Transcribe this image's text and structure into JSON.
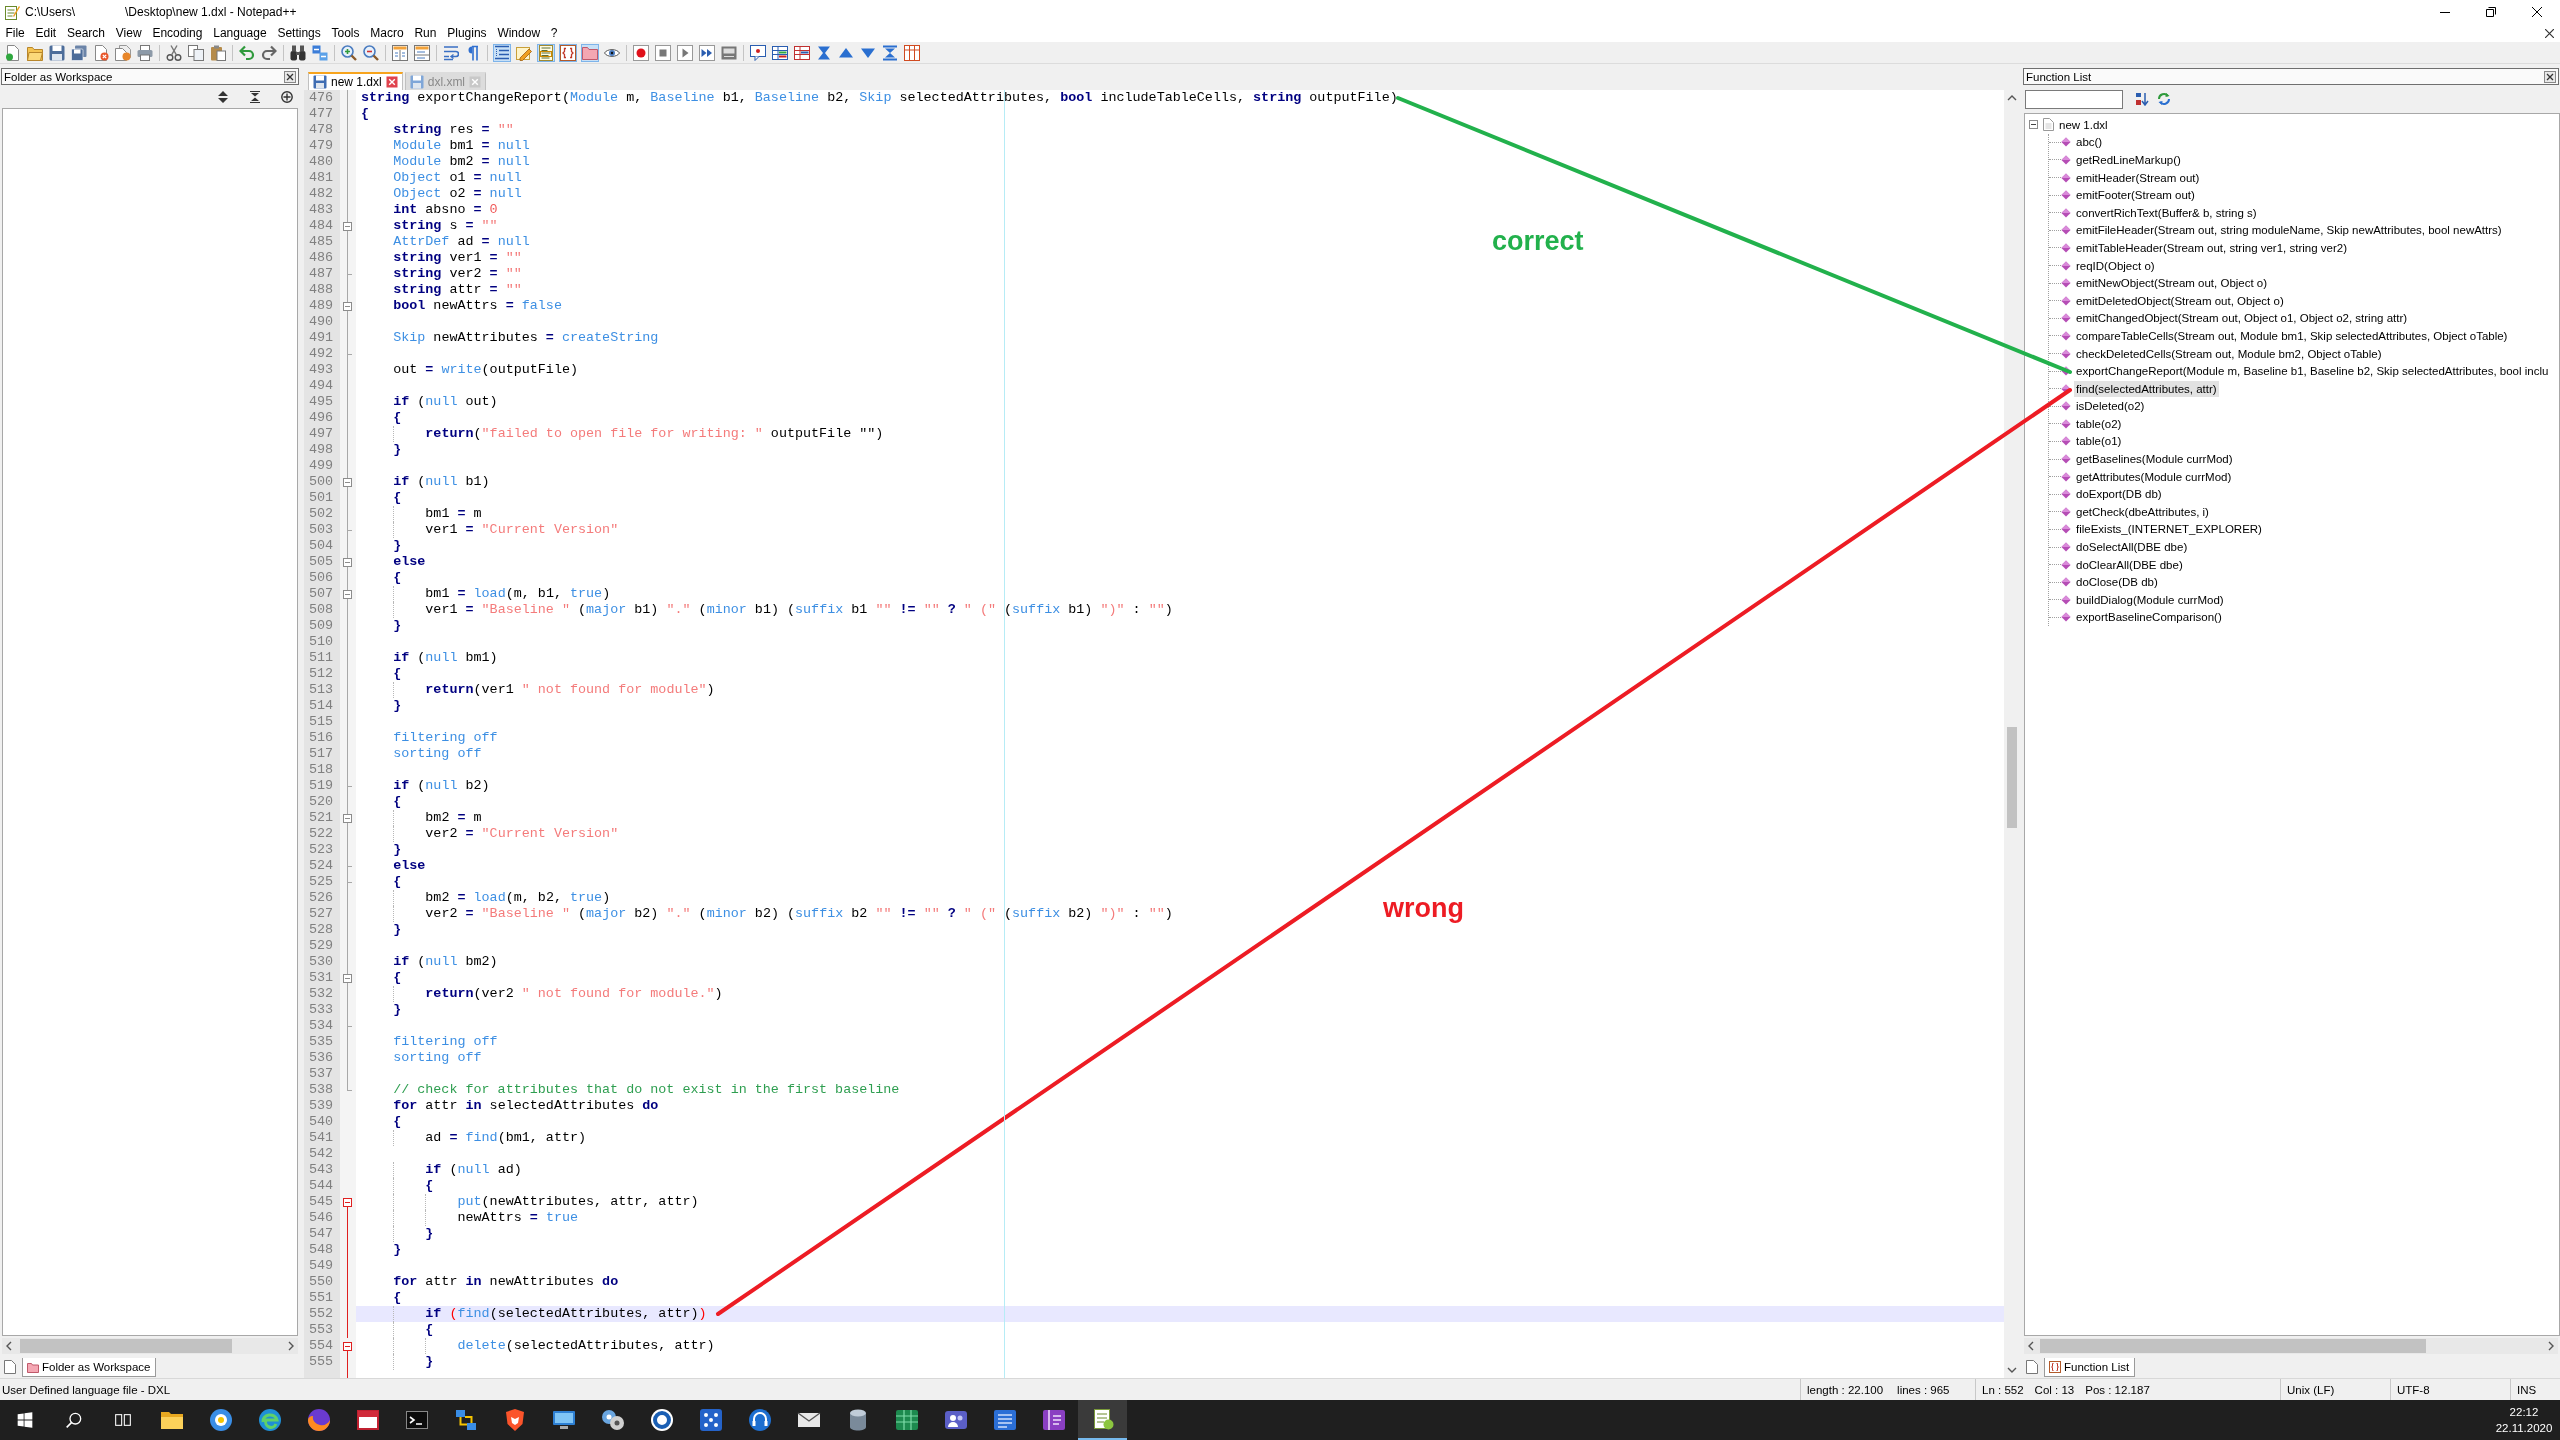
{
  "window": {
    "title_segments": [
      "C:\\Users\\",
      "\\Desktop\\new 1.dxl - Notepad++"
    ]
  },
  "menu": [
    "File",
    "Edit",
    "Search",
    "View",
    "Encoding",
    "Language",
    "Settings",
    "Tools",
    "Macro",
    "Run",
    "Plugins",
    "Window",
    "?"
  ],
  "toolbar": [
    {
      "pressed": false
    },
    {
      "pressed": false
    },
    {
      "pressed": false
    },
    {
      "pressed": false
    },
    {
      "pressed": false
    },
    {
      "pressed": false
    },
    {
      "pressed": false
    },
    {
      "pressed": false
    },
    {
      "pressed": false
    },
    {
      "pressed": false
    },
    {
      "pressed": false
    },
    {
      "pressed": false
    },
    {
      "pressed": false
    },
    {
      "pressed": false
    },
    {
      "pressed": false
    },
    {
      "pressed": false
    },
    {
      "pressed": false
    },
    {
      "pressed": false
    },
    {
      "pressed": false
    },
    {
      "pressed": false
    },
    {
      "pressed": true
    },
    {
      "pressed": false
    },
    {
      "pressed": true
    },
    {
      "pressed": true
    },
    {
      "pressed": true
    },
    {
      "pressed": false
    },
    {
      "pressed": false
    },
    {
      "pressed": false
    },
    {
      "pressed": false
    },
    {
      "pressed": false
    },
    {
      "pressed": false
    },
    {
      "pressed": false
    },
    {
      "pressed": false
    },
    {
      "pressed": false
    },
    {
      "pressed": false
    },
    {
      "pressed": false
    },
    {
      "pressed": false
    },
    {
      "pressed": false
    },
    {
      "pressed": false
    }
  ],
  "workspace_panel": {
    "title": "Folder as Workspace",
    "tab": "Folder as Workspace"
  },
  "editor": {
    "tabs": [
      {
        "label": "new 1.dxl",
        "selected": true
      },
      {
        "label": "dxl.xml",
        "selected": false
      }
    ],
    "lines": [
      {
        "number": "476",
        "current": false,
        "kind": "guide",
        "code": [
          {
            "text": "string",
            "kind": "keyword"
          },
          {
            "text": " exportChangeReport(",
            "kind": "plain"
          },
          {
            "text": "Module",
            "kind": "builtin"
          },
          {
            "text": " m, ",
            "kind": "plain"
          },
          {
            "text": "Baseline",
            "kind": "builtin"
          },
          {
            "text": " b1, ",
            "kind": "plain"
          },
          {
            "text": "Baseline",
            "kind": "builtin"
          },
          {
            "text": " b2, ",
            "kind": "plain"
          },
          {
            "text": "Skip",
            "kind": "builtin"
          },
          {
            "text": " selectedAttributes, ",
            "kind": "plain"
          },
          {
            "text": "bool",
            "kind": "keyword"
          },
          {
            "text": " includeTableCells, ",
            "kind": "plain"
          },
          {
            "text": "string",
            "kind": "keyword"
          },
          {
            "text": " outputFile)",
            "kind": "plain"
          }
        ]
      },
      {
        "number": "477",
        "current": false,
        "kind": "guide",
        "code": [
          {
            "text": "{",
            "kind": "operator"
          }
        ]
      },
      {
        "number": "478",
        "current": false,
        "kind": "guide",
        "code": [
          {
            "text": "    string",
            "kind": "keyword"
          },
          {
            "text": " res ",
            "kind": "plain"
          },
          {
            "text": "=",
            "kind": "operator"
          },
          {
            "text": " \"\"",
            "kind": "string"
          }
        ]
      },
      {
        "number": "479",
        "current": false,
        "kind": "guide",
        "code": [
          {
            "text": "    Module",
            "kind": "builtin"
          },
          {
            "text": " bm1 ",
            "kind": "plain"
          },
          {
            "text": "=",
            "kind": "operator"
          },
          {
            "text": " null",
            "kind": "builtin"
          }
        ]
      },
      {
        "number": "480",
        "current": false,
        "kind": "guide",
        "code": [
          {
            "text": "    Module",
            "kind": "builtin"
          },
          {
            "text": " bm2 ",
            "kind": "plain"
          },
          {
            "text": "=",
            "kind": "operator"
          },
          {
            "text": " null",
            "kind": "builtin"
          }
        ]
      },
      {
        "number": "481",
        "current": false,
        "kind": "guide",
        "code": [
          {
            "text": "    Object",
            "kind": "builtin"
          },
          {
            "text": " o1 ",
            "kind": "plain"
          },
          {
            "text": "=",
            "kind": "operator"
          },
          {
            "text": " null",
            "kind": "builtin"
          }
        ]
      },
      {
        "number": "482",
        "current": false,
        "kind": "guide",
        "code": [
          {
            "text": "    Object",
            "kind": "builtin"
          },
          {
            "text": " o2 ",
            "kind": "plain"
          },
          {
            "text": "=",
            "kind": "operator"
          },
          {
            "text": " null",
            "kind": "builtin"
          }
        ]
      },
      {
        "number": "483",
        "current": false,
        "kind": "guide",
        "code": [
          {
            "text": "    int",
            "kind": "keyword"
          },
          {
            "text": " absno ",
            "kind": "plain"
          },
          {
            "text": "=",
            "kind": "operator"
          },
          {
            "text": " 0",
            "kind": "number"
          }
        ]
      },
      {
        "number": "484",
        "current": false,
        "kind": "folder",
        "code": [
          {
            "text": "    string",
            "kind": "keyword"
          },
          {
            "text": " s ",
            "kind": "plain"
          },
          {
            "text": "=",
            "kind": "operator"
          },
          {
            "text": " \"\"",
            "kind": "string"
          }
        ]
      },
      {
        "number": "485",
        "current": false,
        "kind": "guide",
        "code": [
          {
            "text": "    AttrDef",
            "kind": "builtin"
          },
          {
            "text": " ad ",
            "kind": "plain"
          },
          {
            "text": "=",
            "kind": "operator"
          },
          {
            "text": " null",
            "kind": "builtin"
          }
        ]
      },
      {
        "number": "486",
        "current": false,
        "kind": "guide",
        "code": [
          {
            "text": "    string",
            "kind": "keyword"
          },
          {
            "text": " ver1 ",
            "kind": "plain"
          },
          {
            "text": "=",
            "kind": "operator"
          },
          {
            "text": " \"\"",
            "kind": "string"
          }
        ]
      },
      {
        "number": "487",
        "current": false,
        "kind": "tick",
        "code": [
          {
            "text": "    string",
            "kind": "keyword"
          },
          {
            "text": " ver2 ",
            "kind": "plain"
          },
          {
            "text": "=",
            "kind": "operator"
          },
          {
            "text": " \"\"",
            "kind": "string"
          }
        ]
      },
      {
        "number": "488",
        "current": false,
        "kind": "guide",
        "code": [
          {
            "text": "    string",
            "kind": "keyword"
          },
          {
            "text": " attr ",
            "kind": "plain"
          },
          {
            "text": "=",
            "kind": "operator"
          },
          {
            "text": " \"\"",
            "kind": "string"
          }
        ]
      },
      {
        "number": "489",
        "current": false,
        "kind": "folder",
        "code": [
          {
            "text": "    bool",
            "kind": "keyword"
          },
          {
            "text": " newAttrs ",
            "kind": "plain"
          },
          {
            "text": "=",
            "kind": "operator"
          },
          {
            "text": " false",
            "kind": "builtin"
          }
        ]
      },
      {
        "number": "490",
        "current": false,
        "kind": "guide"
      },
      {
        "number": "491",
        "current": false,
        "kind": "guide",
        "code": [
          {
            "text": "    Skip",
            "kind": "builtin"
          },
          {
            "text": " newAttributes ",
            "kind": "plain"
          },
          {
            "text": "=",
            "kind": "operator"
          },
          {
            "text": " createString",
            "kind": "builtin"
          }
        ]
      },
      {
        "number": "492",
        "current": false,
        "kind": "tick"
      },
      {
        "number": "493",
        "current": false,
        "kind": "guide",
        "code": [
          {
            "text": "    out ",
            "kind": "plain"
          },
          {
            "text": "=",
            "kind": "operator"
          },
          {
            "text": " write",
            "kind": "builtin"
          },
          {
            "text": "(outputFile)",
            "kind": "plain"
          }
        ]
      },
      {
        "number": "494",
        "current": false,
        "kind": "guide"
      },
      {
        "number": "495",
        "current": false,
        "kind": "guide",
        "code": [
          {
            "text": "    if",
            "kind": "keyword"
          },
          {
            "text": " (",
            "kind": "plain"
          },
          {
            "text": "null",
            "kind": "builtin"
          },
          {
            "text": " out)",
            "kind": "plain"
          }
        ]
      },
      {
        "number": "496",
        "current": false,
        "kind": "guide",
        "code": [
          {
            "text": "    {",
            "kind": "operator"
          }
        ]
      },
      {
        "number": "497",
        "current": false,
        "kind": "guide",
        "code": [
          {
            "text": "        return",
            "kind": "keyword"
          },
          {
            "text": "(",
            "kind": "plain"
          },
          {
            "text": "\"failed to open file for writing: \"",
            "kind": "string"
          },
          {
            "text": " outputFile \"\")",
            "kind": "plain"
          }
        ]
      },
      {
        "number": "498",
        "current": false,
        "kind": "guide",
        "code": [
          {
            "text": "    }",
            "kind": "operator"
          }
        ]
      },
      {
        "number": "499",
        "current": false,
        "kind": "guide"
      },
      {
        "number": "500",
        "current": false,
        "kind": "folder",
        "code": [
          {
            "text": "    if",
            "kind": "keyword"
          },
          {
            "text": " (",
            "kind": "plain"
          },
          {
            "text": "null",
            "kind": "builtin"
          },
          {
            "text": " b1)",
            "kind": "plain"
          }
        ]
      },
      {
        "number": "501",
        "current": false,
        "kind": "guide",
        "code": [
          {
            "text": "    {",
            "kind": "operator"
          }
        ]
      },
      {
        "number": "502",
        "current": false,
        "kind": "guide",
        "code": [
          {
            "text": "        bm1 ",
            "kind": "plain"
          },
          {
            "text": "=",
            "kind": "operator"
          },
          {
            "text": " m",
            "kind": "plain"
          }
        ]
      },
      {
        "number": "503",
        "current": false,
        "kind": "tick",
        "code": [
          {
            "text": "        ver1 ",
            "kind": "plain"
          },
          {
            "text": "=",
            "kind": "operator"
          },
          {
            "text": " \"Current Version\"",
            "kind": "string"
          }
        ]
      },
      {
        "number": "504",
        "current": false,
        "kind": "guide",
        "code": [
          {
            "text": "    }",
            "kind": "operator"
          }
        ]
      },
      {
        "number": "505",
        "current": false,
        "kind": "folder",
        "code": [
          {
            "text": "    else",
            "kind": "keyword"
          }
        ]
      },
      {
        "number": "506",
        "current": false,
        "kind": "guide",
        "code": [
          {
            "text": "    {",
            "kind": "operator"
          }
        ]
      },
      {
        "number": "507",
        "current": false,
        "kind": "folder",
        "code": [
          {
            "text": "        bm1 ",
            "kind": "plain"
          },
          {
            "text": "=",
            "kind": "operator"
          },
          {
            "text": " load",
            "kind": "builtin"
          },
          {
            "text": "(m, b1, ",
            "kind": "plain"
          },
          {
            "text": "true",
            "kind": "builtin"
          },
          {
            "text": ")",
            "kind": "plain"
          }
        ]
      },
      {
        "number": "508",
        "current": false,
        "kind": "guide",
        "code": [
          {
            "text": "        ver1 ",
            "kind": "plain"
          },
          {
            "text": "=",
            "kind": "operator"
          },
          {
            "text": " \"Baseline \"",
            "kind": "string"
          },
          {
            "text": " (",
            "kind": "plain"
          },
          {
            "text": "major",
            "kind": "builtin"
          },
          {
            "text": " b1) ",
            "kind": "plain"
          },
          {
            "text": "\".\"",
            "kind": "string"
          },
          {
            "text": " (",
            "kind": "plain"
          },
          {
            "text": "minor",
            "kind": "builtin"
          },
          {
            "text": " b1) (",
            "kind": "plain"
          },
          {
            "text": "suffix",
            "kind": "builtin"
          },
          {
            "text": " b1 ",
            "kind": "plain"
          },
          {
            "text": "\"\"",
            "kind": "string"
          },
          {
            "text": " !=",
            "kind": "operator"
          },
          {
            "text": " \"\"",
            "kind": "string"
          },
          {
            "text": " ?",
            "kind": "operator"
          },
          {
            "text": " \" (\"",
            "kind": "string"
          },
          {
            "text": " (",
            "kind": "plain"
          },
          {
            "text": "suffix",
            "kind": "builtin"
          },
          {
            "text": " b1) ",
            "kind": "plain"
          },
          {
            "text": "\")\"",
            "kind": "string"
          },
          {
            "text": " : ",
            "kind": "plain"
          },
          {
            "text": "\"\"",
            "kind": "string"
          },
          {
            "text": ")",
            "kind": "plain"
          }
        ]
      },
      {
        "number": "509",
        "current": false,
        "kind": "guide",
        "code": [
          {
            "text": "    }",
            "kind": "operator"
          }
        ]
      },
      {
        "number": "510",
        "current": false,
        "kind": "guide"
      },
      {
        "number": "511",
        "current": false,
        "kind": "guide",
        "code": [
          {
            "text": "    if",
            "kind": "keyword"
          },
          {
            "text": " (",
            "kind": "plain"
          },
          {
            "text": "null",
            "kind": "builtin"
          },
          {
            "text": " bm1)",
            "kind": "plain"
          }
        ]
      },
      {
        "number": "512",
        "current": false,
        "kind": "guide",
        "code": [
          {
            "text": "    {",
            "kind": "operator"
          }
        ]
      },
      {
        "number": "513",
        "current": false,
        "kind": "guide",
        "code": [
          {
            "text": "        return",
            "kind": "keyword"
          },
          {
            "text": "(ver1 ",
            "kind": "plain"
          },
          {
            "text": "\" not found for module\"",
            "kind": "string"
          },
          {
            "text": ")",
            "kind": "plain"
          }
        ]
      },
      {
        "number": "514",
        "current": false,
        "kind": "guide",
        "code": [
          {
            "text": "    }",
            "kind": "operator"
          }
        ]
      },
      {
        "number": "515",
        "current": false,
        "kind": "guide"
      },
      {
        "number": "516",
        "current": false,
        "kind": "guide",
        "code": [
          {
            "text": "    filtering off",
            "kind": "builtin"
          }
        ]
      },
      {
        "number": "517",
        "current": false,
        "kind": "guide",
        "code": [
          {
            "text": "    sorting off",
            "kind": "builtin"
          }
        ]
      },
      {
        "number": "518",
        "current": false,
        "kind": "guide"
      },
      {
        "number": "519",
        "current": false,
        "kind": "tick",
        "code": [
          {
            "text": "    if",
            "kind": "keyword"
          },
          {
            "text": " (",
            "kind": "plain"
          },
          {
            "text": "null",
            "kind": "builtin"
          },
          {
            "text": " b2)",
            "kind": "plain"
          }
        ]
      },
      {
        "number": "520",
        "current": false,
        "kind": "guide",
        "code": [
          {
            "text": "    {",
            "kind": "operator"
          }
        ]
      },
      {
        "number": "521",
        "current": false,
        "kind": "folder",
        "code": [
          {
            "text": "        bm2 ",
            "kind": "plain"
          },
          {
            "text": "=",
            "kind": "operator"
          },
          {
            "text": " m",
            "kind": "plain"
          }
        ]
      },
      {
        "number": "522",
        "current": false,
        "kind": "guide",
        "code": [
          {
            "text": "        ver2 ",
            "kind": "plain"
          },
          {
            "text": "=",
            "kind": "operator"
          },
          {
            "text": " \"Current Version\"",
            "kind": "string"
          }
        ]
      },
      {
        "number": "523",
        "current": false,
        "kind": "guide",
        "code": [
          {
            "text": "    }",
            "kind": "operator"
          }
        ]
      },
      {
        "number": "524",
        "current": false,
        "kind": "tick",
        "code": [
          {
            "text": "    else",
            "kind": "keyword"
          }
        ]
      },
      {
        "number": "525",
        "current": false,
        "kind": "tick",
        "code": [
          {
            "text": "    {",
            "kind": "operator"
          }
        ]
      },
      {
        "number": "526",
        "current": false,
        "kind": "guide",
        "code": [
          {
            "text": "        bm2 ",
            "kind": "plain"
          },
          {
            "text": "=",
            "kind": "operator"
          },
          {
            "text": " load",
            "kind": "builtin"
          },
          {
            "text": "(m, b2, ",
            "kind": "plain"
          },
          {
            "text": "true",
            "kind": "builtin"
          },
          {
            "text": ")",
            "kind": "plain"
          }
        ]
      },
      {
        "number": "527",
        "current": false,
        "kind": "guide",
        "code": [
          {
            "text": "        ver2 ",
            "kind": "plain"
          },
          {
            "text": "=",
            "kind": "operator"
          },
          {
            "text": " \"Baseline \"",
            "kind": "string"
          },
          {
            "text": " (",
            "kind": "plain"
          },
          {
            "text": "major",
            "kind": "builtin"
          },
          {
            "text": " b2) ",
            "kind": "plain"
          },
          {
            "text": "\".\"",
            "kind": "string"
          },
          {
            "text": " (",
            "kind": "plain"
          },
          {
            "text": "minor",
            "kind": "builtin"
          },
          {
            "text": " b2) (",
            "kind": "plain"
          },
          {
            "text": "suffix",
            "kind": "builtin"
          },
          {
            "text": " b2 ",
            "kind": "plain"
          },
          {
            "text": "\"\"",
            "kind": "string"
          },
          {
            "text": " !=",
            "kind": "operator"
          },
          {
            "text": " \"\"",
            "kind": "string"
          },
          {
            "text": " ?",
            "kind": "operator"
          },
          {
            "text": " \" (\"",
            "kind": "string"
          },
          {
            "text": " (",
            "kind": "plain"
          },
          {
            "text": "suffix",
            "kind": "builtin"
          },
          {
            "text": " b2) ",
            "kind": "plain"
          },
          {
            "text": "\")\"",
            "kind": "string"
          },
          {
            "text": " : ",
            "kind": "plain"
          },
          {
            "text": "\"\"",
            "kind": "string"
          },
          {
            "text": ")",
            "kind": "plain"
          }
        ]
      },
      {
        "number": "528",
        "current": false,
        "kind": "guide",
        "code": [
          {
            "text": "    }",
            "kind": "operator"
          }
        ]
      },
      {
        "number": "529",
        "current": false,
        "kind": "guide"
      },
      {
        "number": "530",
        "current": false,
        "kind": "guide",
        "code": [
          {
            "text": "    if",
            "kind": "keyword"
          },
          {
            "text": " (",
            "kind": "plain"
          },
          {
            "text": "null",
            "kind": "builtin"
          },
          {
            "text": " bm2)",
            "kind": "plain"
          }
        ]
      },
      {
        "number": "531",
        "current": false,
        "kind": "folder",
        "code": [
          {
            "text": "    {",
            "kind": "operator"
          }
        ]
      },
      {
        "number": "532",
        "current": false,
        "kind": "guide",
        "code": [
          {
            "text": "        return",
            "kind": "keyword"
          },
          {
            "text": "(ver2 ",
            "kind": "plain"
          },
          {
            "text": "\" not found for module.\"",
            "kind": "string"
          },
          {
            "text": ")",
            "kind": "plain"
          }
        ]
      },
      {
        "number": "533",
        "current": false,
        "kind": "guide",
        "code": [
          {
            "text": "    }",
            "kind": "operator"
          }
        ]
      },
      {
        "number": "534",
        "current": false,
        "kind": "tick"
      },
      {
        "number": "535",
        "current": false,
        "kind": "guide",
        "code": [
          {
            "text": "    filtering off",
            "kind": "builtin"
          }
        ]
      },
      {
        "number": "536",
        "current": false,
        "kind": "guide",
        "code": [
          {
            "text": "    sorting off",
            "kind": "builtin"
          }
        ]
      },
      {
        "number": "537",
        "current": false,
        "kind": "guide"
      },
      {
        "number": "538",
        "current": false,
        "kind": "end",
        "code": [
          {
            "text": "    // check for attributes that do not exist in the first baseline",
            "kind": "comment"
          }
        ]
      },
      {
        "number": "539",
        "current": false,
        "kind": "bare",
        "code": [
          {
            "text": "    for",
            "kind": "keyword"
          },
          {
            "text": " attr ",
            "kind": "plain"
          },
          {
            "text": "in",
            "kind": "keyword"
          },
          {
            "text": " selectedAttributes ",
            "kind": "plain"
          },
          {
            "text": "do",
            "kind": "keyword"
          }
        ]
      },
      {
        "number": "540",
        "current": false,
        "kind": "bare",
        "code": [
          {
            "text": "    {",
            "kind": "operator"
          }
        ]
      },
      {
        "number": "541",
        "current": false,
        "kind": "bare",
        "code": [
          {
            "text": "        ad ",
            "kind": "plain"
          },
          {
            "text": "=",
            "kind": "operator"
          },
          {
            "text": " find",
            "kind": "builtin"
          },
          {
            "text": "(bm1, attr)",
            "kind": "plain"
          }
        ]
      },
      {
        "number": "542",
        "current": false,
        "kind": "bare"
      },
      {
        "number": "543",
        "current": false,
        "kind": "bare",
        "code": [
          {
            "text": "        if",
            "kind": "keyword"
          },
          {
            "text": " (",
            "kind": "plain"
          },
          {
            "text": "null",
            "kind": "builtin"
          },
          {
            "text": " ad)",
            "kind": "plain"
          }
        ]
      },
      {
        "number": "544",
        "current": false,
        "kind": "bare",
        "code": [
          {
            "text": "        {",
            "kind": "operator"
          }
        ]
      },
      {
        "number": "545",
        "current": false,
        "kind": "activefolder",
        "code": [
          {
            "text": "            put",
            "kind": "builtin"
          },
          {
            "text": "(newAttributes, attr, attr)",
            "kind": "plain"
          }
        ]
      },
      {
        "number": "546",
        "current": false,
        "kind": "active",
        "code": [
          {
            "text": "            newAttrs ",
            "kind": "plain"
          },
          {
            "text": "=",
            "kind": "operator"
          },
          {
            "text": " true",
            "kind": "builtin"
          }
        ]
      },
      {
        "number": "547",
        "current": false,
        "kind": "active",
        "code": [
          {
            "text": "        }",
            "kind": "operator"
          }
        ]
      },
      {
        "number": "548",
        "current": false,
        "kind": "active",
        "code": [
          {
            "text": "    }",
            "kind": "operator"
          }
        ]
      },
      {
        "number": "549",
        "current": false,
        "kind": "active"
      },
      {
        "number": "550",
        "current": false,
        "kind": "active",
        "code": [
          {
            "text": "    for",
            "kind": "keyword"
          },
          {
            "text": " attr ",
            "kind": "plain"
          },
          {
            "text": "in",
            "kind": "keyword"
          },
          {
            "text": " newAttributes ",
            "kind": "plain"
          },
          {
            "text": "do",
            "kind": "keyword"
          }
        ]
      },
      {
        "number": "551",
        "current": false,
        "kind": "active",
        "code": [
          {
            "text": "    {",
            "kind": "operator"
          }
        ]
      },
      {
        "number": "552",
        "current": true,
        "kind": "active",
        "code": [
          {
            "text": "        if ",
            "kind": "keyword"
          },
          {
            "text": "(",
            "kind": "match"
          },
          {
            "text": "find",
            "kind": "builtin"
          },
          {
            "text": "(selectedAttributes, attr)",
            "kind": "plain"
          },
          {
            "text": ")",
            "kind": "match"
          }
        ]
      },
      {
        "number": "553",
        "current": false,
        "kind": "active",
        "code": [
          {
            "text": "        {",
            "kind": "operator"
          }
        ]
      },
      {
        "number": "554",
        "current": false,
        "kind": "activefolder",
        "code": [
          {
            "text": "            delete",
            "kind": "builtin"
          },
          {
            "text": "(selectedAttributes, attr)",
            "kind": "plain"
          }
        ]
      },
      {
        "number": "555",
        "current": false,
        "kind": "active",
        "code": [
          {
            "text": "        }",
            "kind": "operator"
          }
        ]
      }
    ]
  },
  "function_list": {
    "title": "Function List",
    "tree": {
      "label": "new 1.dxl",
      "expanded": true,
      "children": [
        {
          "label": "abc()",
          "selected": false
        },
        {
          "label": "getRedLineMarkup()",
          "selected": false
        },
        {
          "label": "emitHeader(Stream out)",
          "selected": false
        },
        {
          "label": "emitFooter(Stream out)",
          "selected": false
        },
        {
          "label": "convertRichText(Buffer& b, string s)",
          "selected": false
        },
        {
          "label": "emitFileHeader(Stream out, string moduleName, Skip newAttributes, bool newAttrs)",
          "selected": false
        },
        {
          "label": "emitTableHeader(Stream out, string ver1, string ver2)",
          "selected": false
        },
        {
          "label": "reqID(Object o)",
          "selected": false
        },
        {
          "label": "emitNewObject(Stream out, Object o)",
          "selected": false
        },
        {
          "label": "emitDeletedObject(Stream out, Object o)",
          "selected": false
        },
        {
          "label": "emitChangedObject(Stream out, Object o1, Object o2, string attr)",
          "selected": false
        },
        {
          "label": "compareTableCells(Stream out, Module bm1, Skip selectedAttributes, Object oTable)",
          "selected": false
        },
        {
          "label": "checkDeletedCells(Stream out, Module bm2, Object oTable)",
          "selected": false
        },
        {
          "label": "exportChangeReport(Module m, Baseline b1, Baseline b2, Skip selectedAttributes, bool inclu",
          "selected": false
        },
        {
          "label": "find(selectedAttributes, attr)",
          "selected": true
        },
        {
          "label": "isDeleted(o2)",
          "selected": false
        },
        {
          "label": "table(o2)",
          "selected": false
        },
        {
          "label": "table(o1)",
          "selected": false
        },
        {
          "label": "getBaselines(Module currMod)",
          "selected": false
        },
        {
          "label": "getAttributes(Module currMod)",
          "selected": false
        },
        {
          "label": "doExport(DB db)",
          "selected": false
        },
        {
          "label": "getCheck(dbeAttributes, i)",
          "selected": false
        },
        {
          "label": "fileExists_(INTERNET_EXPLORER)",
          "selected": false
        },
        {
          "label": "doSelectAll(DBE dbe)",
          "selected": false
        },
        {
          "label": "doClearAll(DBE dbe)",
          "selected": false
        },
        {
          "label": "doClose(DB db)",
          "selected": false
        },
        {
          "label": "buildDialog(Module currMod)",
          "selected": false
        },
        {
          "label": "exportBaselineComparison()",
          "selected": false
        }
      ]
    },
    "tab": "Function List"
  },
  "annotations": [
    {
      "text": "correct",
      "color": "#22b14c"
    },
    {
      "text": "wrong",
      "color": "#ed1c24"
    }
  ],
  "status_bar": {
    "language": "User Defined language file - DXL",
    "length": "length : 22.100",
    "lines": "lines : 965",
    "line": "Ln : 552",
    "column": "Col : 13",
    "position": "Pos : 12.187",
    "eol": "Unix (LF)",
    "encoding": "UTF-8",
    "mode": "INS"
  },
  "taskbar": {
    "apps": [
      {
        "active": false
      },
      {
        "active": false
      },
      {
        "active": false
      },
      {
        "active": false
      },
      {
        "active": false
      },
      {
        "active": false
      },
      {
        "active": false
      },
      {
        "active": false
      },
      {
        "active": false
      },
      {
        "active": false
      },
      {
        "active": false
      },
      {
        "active": false
      },
      {
        "active": false
      },
      {
        "active": false
      },
      {
        "active": false
      },
      {
        "active": false
      },
      {
        "active": false
      },
      {
        "active": false
      },
      {
        "active": false
      },
      {
        "active": true
      }
    ],
    "time": "22:12",
    "date": "22.11.2020"
  }
}
